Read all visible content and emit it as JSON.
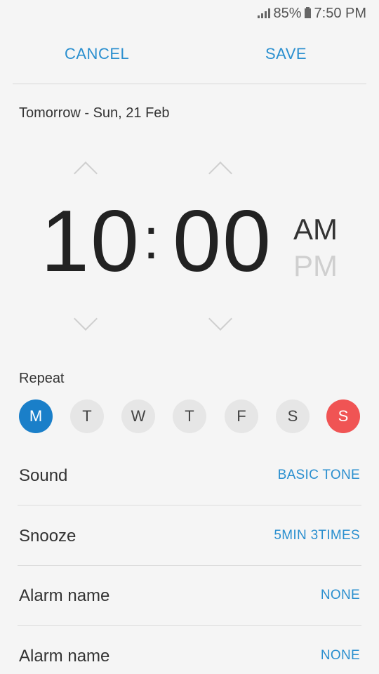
{
  "status_bar": {
    "battery": "85%",
    "time": "7:50 PM",
    "signal_icon": "signal-icon",
    "battery_icon": "battery-icon"
  },
  "action_bar": {
    "cancel_label": "CANCEL",
    "save_label": "SAVE"
  },
  "date_label": "Tomorrow - Sun, 21 Feb",
  "time_picker": {
    "hour": "10",
    "separator": ":",
    "minute": "00",
    "am_label": "AM",
    "pm_label": "PM",
    "selected_period": "AM"
  },
  "repeat": {
    "label": "Repeat",
    "days": [
      {
        "letter": "M",
        "selected": true
      },
      {
        "letter": "T",
        "selected": false
      },
      {
        "letter": "W",
        "selected": false
      },
      {
        "letter": "T",
        "selected": false
      },
      {
        "letter": "F",
        "selected": false
      },
      {
        "letter": "S",
        "selected": false
      },
      {
        "letter": "S",
        "selected": false
      }
    ]
  },
  "settings": [
    {
      "label": "Sound",
      "value": "BASIC TONE"
    },
    {
      "label": "Snooze",
      "value": "5MIN 3TIMES"
    },
    {
      "label": "Alarm name",
      "value": "NONE"
    },
    {
      "label": "Alarm name",
      "value": "NONE"
    }
  ],
  "colors": {
    "accent": "#2a8fcf",
    "selected_day": "#1a7fc9",
    "sunday": "#f05454",
    "background": "#f5f5f5"
  }
}
